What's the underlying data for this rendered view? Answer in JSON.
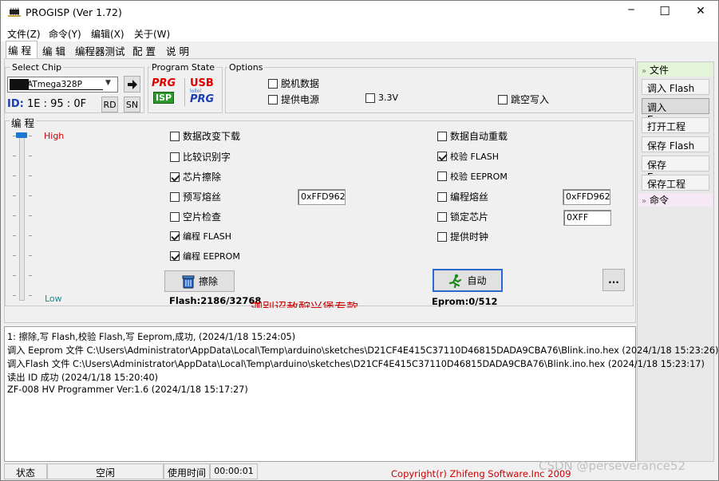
{
  "window": {
    "title": "PROGISP (Ver 1.72)",
    "controls": {
      "minimize": "─",
      "maximize": "☐",
      "close": "✕"
    }
  },
  "menu": [
    "文件(Z)",
    "命令(Y)",
    "编辑(X)",
    "关于(W)"
  ],
  "tabs": [
    "编 程",
    "编 辑",
    "编程器测试",
    "配 置",
    "说 明"
  ],
  "select_chip": {
    "title": "Select Chip",
    "chip": "ATmega328P",
    "id_label": "ID:",
    "id_value": "1E : 95 : 0F",
    "rd": "RD",
    "sn": "SN"
  },
  "program_state": {
    "title": "Program State",
    "prg_isp": {
      "top": "PRG",
      "bottom": "ISP"
    },
    "usb_prg": {
      "top": "USB",
      "bottom": "PRG"
    }
  },
  "options": {
    "title": "Options",
    "items": [
      {
        "label": "脱机数据",
        "checked": false
      },
      {
        "label": "提供电源",
        "checked": false
      },
      {
        "label": "3.3V",
        "checked": false
      },
      {
        "label": "跳空写入",
        "checked": false
      }
    ]
  },
  "program": {
    "title": "编 程",
    "slider": {
      "high": "High",
      "low": "Low",
      "level": 1.0
    },
    "left_checks": [
      {
        "label": "数据改变下载",
        "checked": false
      },
      {
        "label": "比较识别字",
        "checked": false
      },
      {
        "label": "芯片擦除",
        "checked": true
      },
      {
        "label": "预写熔丝",
        "checked": false
      },
      {
        "label": "空片检查",
        "checked": false
      },
      {
        "label": "编程 FLASH",
        "checked": true
      },
      {
        "label": "编程 EEPROM",
        "checked": true
      }
    ],
    "right_checks": [
      {
        "label": "数据自动重载",
        "checked": false
      },
      {
        "label": "校验 FLASH",
        "checked": true
      },
      {
        "label": "校验 EEPROM",
        "checked": false
      },
      {
        "label": "编程熔丝",
        "checked": false
      },
      {
        "label": "锁定芯片",
        "checked": false
      },
      {
        "label": "提供时钟",
        "checked": false
      }
    ],
    "prewrite_fuse_value": "0xFFD962",
    "program_fuse_value": "0xFFD962",
    "lock_value": "0XFF",
    "erase_button": "擦除",
    "auto_button": "自动",
    "more_button": "...",
    "flash_info": "Flash:2186/32768",
    "eprom_info": "Eprom:0/512",
    "watermark_fragment": "迦别诏赦酧兴煲专款"
  },
  "sidebar": {
    "file_header": "文件",
    "file_buttons": [
      "调入 Flash",
      "调入 Eeprom",
      "打开工程",
      "保存 Flash",
      "保存 Eeprom",
      "保存工程"
    ],
    "command_header": "命令",
    "selected_index": 1
  },
  "log": [
    "1: 擦除,写 Flash,校验 Flash,写 Eeprom,成功, (2024/1/18 15:24:05)",
    "调入 Eeprom 文件 C:\\Users\\Administrator\\AppData\\Local\\Temp\\arduino\\sketches\\D21CF4E415C37110D46815DADA9CBA76\\Blink.ino.hex (2024/1/18 15:23:26)",
    "调入Flash 文件 C:\\Users\\Administrator\\AppData\\Local\\Temp\\arduino\\sketches\\D21CF4E415C37110D46815DADA9CBA76\\Blink.ino.hex (2024/1/18 15:23:17)",
    "读出 ID 成功 (2024/1/18 15:20:40)",
    "ZF-008 HV Programmer Ver:1.6 (2024/1/18 15:17:27)"
  ],
  "status": {
    "state_label": "状态",
    "state_value": "空闲",
    "time_label": "使用时间",
    "time_value": "00:00:01",
    "copyright": "Copyright(r) Zhifeng Software.Inc 2009",
    "watermark": "CSDN @perseverance52"
  },
  "colors": {
    "prg_red": "#e00000",
    "isp_green": "#2a9a2a",
    "blue_text": "#1a3fb0",
    "copyright_red": "#cc0000",
    "high_red": "#cc0000",
    "low_teal": "#1a8a8a"
  }
}
